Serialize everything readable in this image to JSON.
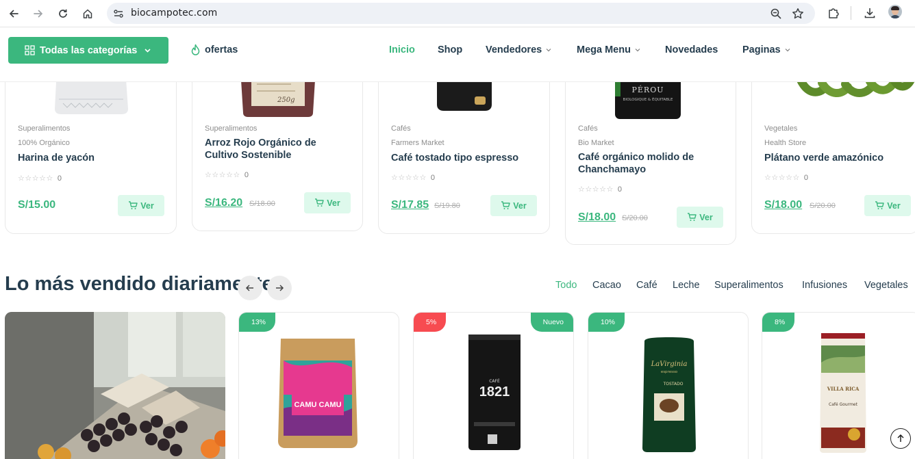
{
  "browser": {
    "url": "biocampotec.com"
  },
  "header": {
    "categories_label": "Todas las categorías",
    "offers_label": "ofertas",
    "menu": [
      {
        "label": "Inicio",
        "active": true
      },
      {
        "label": "Shop"
      },
      {
        "label": "Vendedores",
        "dropdown": true
      },
      {
        "label": "Mega Menu",
        "dropdown": true
      },
      {
        "label": "Novedades"
      },
      {
        "label": "Paginas",
        "dropdown": true
      }
    ]
  },
  "products": [
    {
      "category": "Superalimentos",
      "vendor": "100% Orgánico",
      "name": "Harina de yacón",
      "rating": "0",
      "price": "S/15.00",
      "old_price": "",
      "button": "Ver"
    },
    {
      "category": "Superalimentos",
      "vendor": "",
      "name": "Arroz Rojo Orgánico de Cultivo Sostenible",
      "rating": "0",
      "price": "S/16.20",
      "old_price": "S/18.00",
      "button": "Ver"
    },
    {
      "category": "Cafés",
      "vendor": "Farmers Market",
      "name": "Café tostado tipo espresso",
      "rating": "0",
      "price": "S/17.85",
      "old_price": "S/19.80",
      "button": "Ver"
    },
    {
      "category": "Cafés",
      "vendor": "Bio Market",
      "name": "Café orgánico molido de Chanchamayo",
      "rating": "0",
      "price": "S/18.00",
      "old_price": "S/20.00",
      "button": "Ver"
    },
    {
      "category": "Vegetales",
      "vendor": "Health Store",
      "name": "Plátano verde amazónico",
      "rating": "0",
      "price": "S/18.00",
      "old_price": "S/20.00",
      "button": "Ver"
    }
  ],
  "image_text": {
    "bag_250g": "250g",
    "perou_title": "PÉROU",
    "perou_sub": "BIOLOGIQUE & ÉQUITABLE",
    "camu": "CAMU CAMU",
    "cafe_1821_top": "CAFÉ",
    "cafe_1821": "1821",
    "lavirginia": "LaVirginia",
    "lavirginia_sub": "espresso",
    "tostado": "TOSTADO",
    "villa_rica": "VILLA RICA",
    "villa_gourmet": "Café Gourmet"
  },
  "best_sellers": {
    "title": "Lo más vendido diariamente",
    "tabs": [
      "Todo",
      "Cacao",
      "Café",
      "Leche",
      "Superalimentos",
      "Infusiones",
      "Vegetales"
    ],
    "items": [
      {
        "discount": "13%",
        "discount_color": "#3bb77e",
        "badge": ""
      },
      {
        "discount": "5%",
        "discount_color": "#f74b51",
        "badge": "Nuevo"
      },
      {
        "discount": "10%",
        "discount_color": "#3bb77e",
        "badge": ""
      },
      {
        "discount": "8%",
        "discount_color": "#3bb77e",
        "badge": ""
      }
    ]
  },
  "colors": {
    "brand_green": "#3bb77e",
    "heading": "#253d4e",
    "sale_red": "#f74b51",
    "light_green": "#def9ec"
  }
}
